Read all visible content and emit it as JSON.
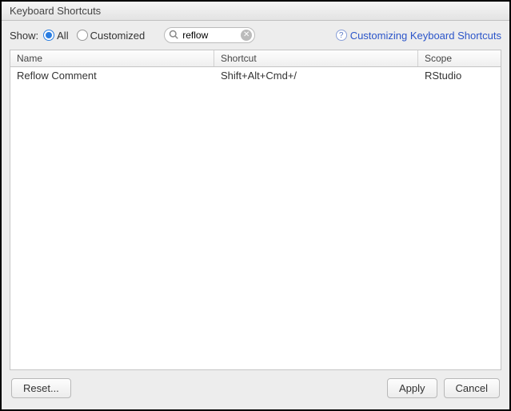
{
  "title": "Keyboard Shortcuts",
  "toolbar": {
    "show_label": "Show:",
    "radio_all": "All",
    "radio_customized": "Customized",
    "search_value": "reflow",
    "help_link": "Customizing Keyboard Shortcuts"
  },
  "table": {
    "headers": {
      "name": "Name",
      "shortcut": "Shortcut",
      "scope": "Scope"
    },
    "rows": [
      {
        "name": "Reflow Comment",
        "shortcut": "Shift+Alt+Cmd+/",
        "scope": "RStudio"
      }
    ]
  },
  "footer": {
    "reset": "Reset...",
    "apply": "Apply",
    "cancel": "Cancel"
  }
}
